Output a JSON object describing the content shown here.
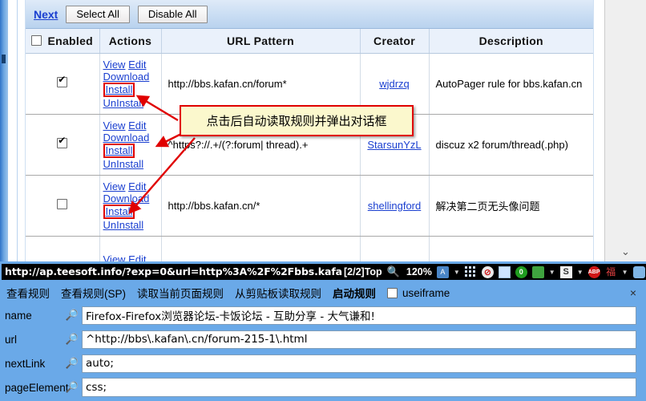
{
  "page": {
    "action_bar": {
      "next_link": "Next",
      "select_all": "Select All",
      "disable_all": "Disable All"
    },
    "table": {
      "headers": [
        "Enabled",
        "Actions",
        "URL Pattern",
        "Creator",
        "Description"
      ],
      "action_labels": [
        "View",
        "Edit",
        "Download",
        "Install",
        "UnInstall"
      ],
      "rows": [
        {
          "enabled": true,
          "url_pattern": "http://bbs.kafan.cn/forum*",
          "creator": "wjdrzq",
          "description": "AutoPager rule for bbs.kafan.cn"
        },
        {
          "enabled": true,
          "url_pattern": "^https?://.+/(?:forum| thread).+",
          "creator": "StarsunYzL",
          "description": "discuz x2 forum/thread(.php)"
        },
        {
          "enabled": false,
          "url_pattern": "http://bbs.kafan.cn/*",
          "creator": "shellingford",
          "description": "解决第二页无头像问题"
        },
        {
          "enabled": false,
          "url_pattern": "",
          "creator": "",
          "description": ""
        }
      ]
    },
    "callout": {
      "text": "点击后自动读取规则并弹出对话框"
    }
  },
  "statusbar": {
    "url": "http://ap.teesoft.info/?exp=0&url=http%3A%2F%2Fbbs.kafa",
    "find_position": "[2/2]Top",
    "zoom": "120%"
  },
  "ext_toolbar": {
    "items": [
      {
        "label": "查看规则",
        "bold": false
      },
      {
        "label": "查看规则(SP)",
        "bold": false
      },
      {
        "label": "读取当前页面规则",
        "bold": false
      },
      {
        "label": "从剪贴板读取规则",
        "bold": false
      },
      {
        "label": "启动规则",
        "bold": true
      }
    ],
    "checkbox_label": "useiframe",
    "checkbox_checked": false,
    "close_label": "×"
  },
  "form": {
    "fields": [
      {
        "label": "name",
        "value": "Firefox-Firefox浏览器论坛-卡饭论坛 - 互助分享 - 大气谦和!"
      },
      {
        "label": "url",
        "value": "^http://bbs\\.kafan\\.cn/forum-215-1\\.html"
      },
      {
        "label": "nextLink",
        "value": "auto;"
      },
      {
        "label": "pageElement",
        "value": "css;"
      }
    ]
  },
  "colors": {
    "accent_blue": "#6aa9e8",
    "link_blue": "#1a3fd0",
    "highlight_red": "#e00000",
    "callout_bg": "#fbf8cd"
  }
}
